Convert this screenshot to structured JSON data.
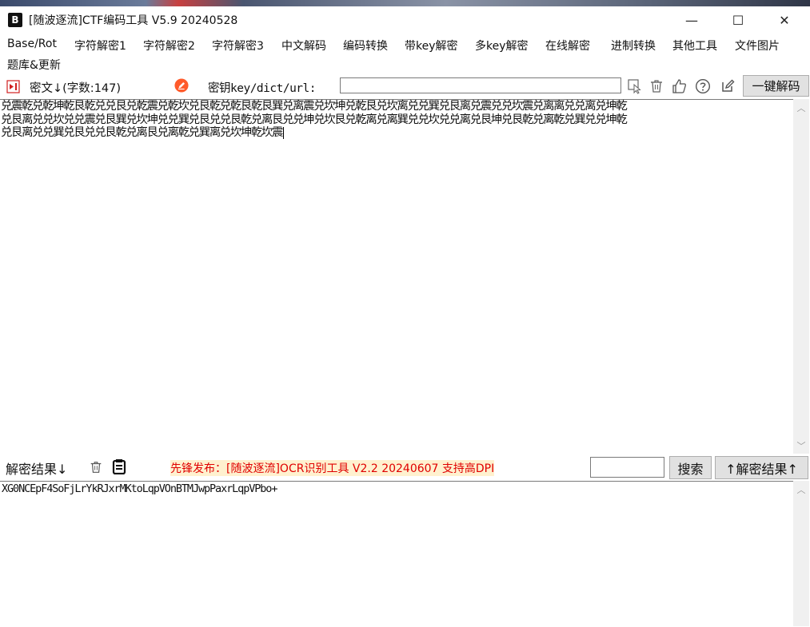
{
  "window": {
    "logo": "B",
    "title": "[随波逐流]CTF编码工具 V5.9 20240528",
    "minimize": "—",
    "maximize": "☐",
    "close": "✕"
  },
  "menu": [
    "Base/Rot",
    "字符解密1",
    "字符解密2",
    "字符解密3",
    "中文解码",
    "编码转换",
    "带key解密",
    "多key解密",
    "在线解密",
    "进制转换",
    "其他工具",
    "文件图片",
    "题库&更新"
  ],
  "toolbar": {
    "cipher_label": "密文↓(字数:147)",
    "key_label": "密钥key/dict/url:",
    "key_value": "",
    "one_click_decode": "一键解码"
  },
  "cipher_text": {
    "lines": [
      "兑震乾兑乾坤乾艮乾兑兑艮兑乾震兑乾坎兑艮乾兑乾艮乾艮巽兑离震兑坎坤兑乾艮兑坎离兑兑巽兑艮离兑震兑兑坎震兑离离兑兑离兑坤乾",
      "兑艮离兑兑坎兑兑震兑艮巽兑坎坤兑兑巽兑艮兑兑艮乾兑离艮兑兑坤兑坎艮兑乾离兑离巽兑兑坎兑兑离兑艮坤兑艮乾兑离乾兑巽兑兑坤乾",
      "兑艮离兑兑巽兑艮兑兑艮乾兑离艮兑离乾兑巽离兑坎坤乾坎震"
    ]
  },
  "result": {
    "label": "解密结果↓",
    "promo": "先锋发布：[随波逐流]OCR识别工具 V2.2 20240607 支持高DPI",
    "search_value": "",
    "search_button": "搜索",
    "up_button": "↑解密结果↑",
    "lines": [
      "XG0NCEpF4SoFjLrYkRJxrMKtoLqpVOnBTMJwpPaxrLqpVPbo+"
    ]
  },
  "colors": {
    "promo_text": "#e00000",
    "promo_bg": "#fff1cf",
    "button_bg": "#e1e1e1",
    "cipher_arrow_icon": "#d02020",
    "clear_key_icon": "#ff5a2a"
  }
}
